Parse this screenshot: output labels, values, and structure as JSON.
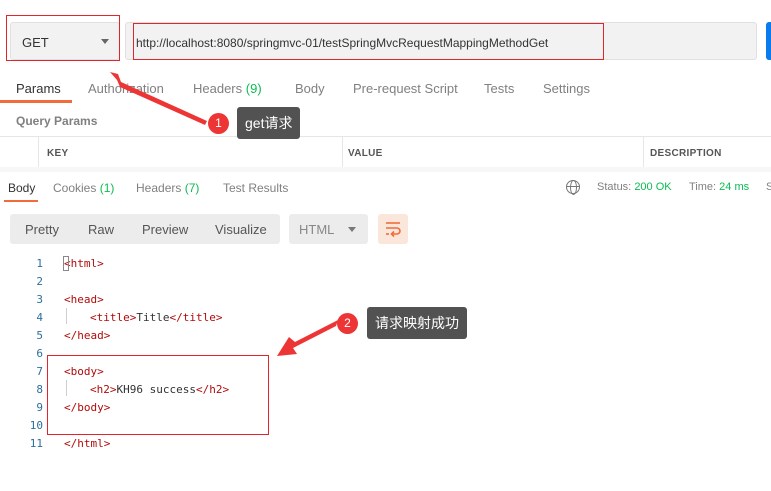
{
  "request": {
    "method": "GET",
    "url": "http://localhost:8080/springmvc-01/testSpringMvcRequestMappingMethodGet"
  },
  "request_tabs": [
    {
      "label": "Params",
      "count": ""
    },
    {
      "label": "Authorization",
      "count": ""
    },
    {
      "label": "Headers",
      "count": "(9)"
    },
    {
      "label": "Body",
      "count": ""
    },
    {
      "label": "Pre-request Script",
      "count": ""
    },
    {
      "label": "Tests",
      "count": ""
    },
    {
      "label": "Settings",
      "count": ""
    }
  ],
  "query_params": {
    "title": "Query Params",
    "columns": [
      "KEY",
      "VALUE",
      "DESCRIPTION"
    ]
  },
  "response_tabs": [
    {
      "label": "Body",
      "count": ""
    },
    {
      "label": "Cookies",
      "count": "(1)"
    },
    {
      "label": "Headers",
      "count": "(7)"
    },
    {
      "label": "Test Results",
      "count": ""
    }
  ],
  "response_status": {
    "status_label": "Status:",
    "status_value": "200 OK",
    "time_label": "Time:",
    "time_value": "24 ms",
    "size_label": "S"
  },
  "view_modes": [
    "Pretty",
    "Raw",
    "Preview",
    "Visualize"
  ],
  "format": "HTML",
  "code_lines": [
    {
      "n": "1",
      "text": "<html>"
    },
    {
      "n": "2",
      "text": ""
    },
    {
      "n": "3",
      "text": "<head>"
    },
    {
      "n": "4",
      "text": "<title>Title</title>"
    },
    {
      "n": "5",
      "text": "</head>"
    },
    {
      "n": "6",
      "text": ""
    },
    {
      "n": "7",
      "text": "<body>"
    },
    {
      "n": "8",
      "text": "<h2>KH96 success</h2>"
    },
    {
      "n": "9",
      "text": "</body>"
    },
    {
      "n": "10",
      "text": ""
    },
    {
      "n": "11",
      "text": "</html>"
    }
  ],
  "annotations": [
    {
      "number": "1",
      "label": "get请求"
    },
    {
      "number": "2",
      "label": "请求映射成功"
    }
  ],
  "colors": {
    "accent": "#f26b3a",
    "status_green": "#0cbb52",
    "annotation_red": "#e0262b",
    "send_blue": "#097bed"
  }
}
